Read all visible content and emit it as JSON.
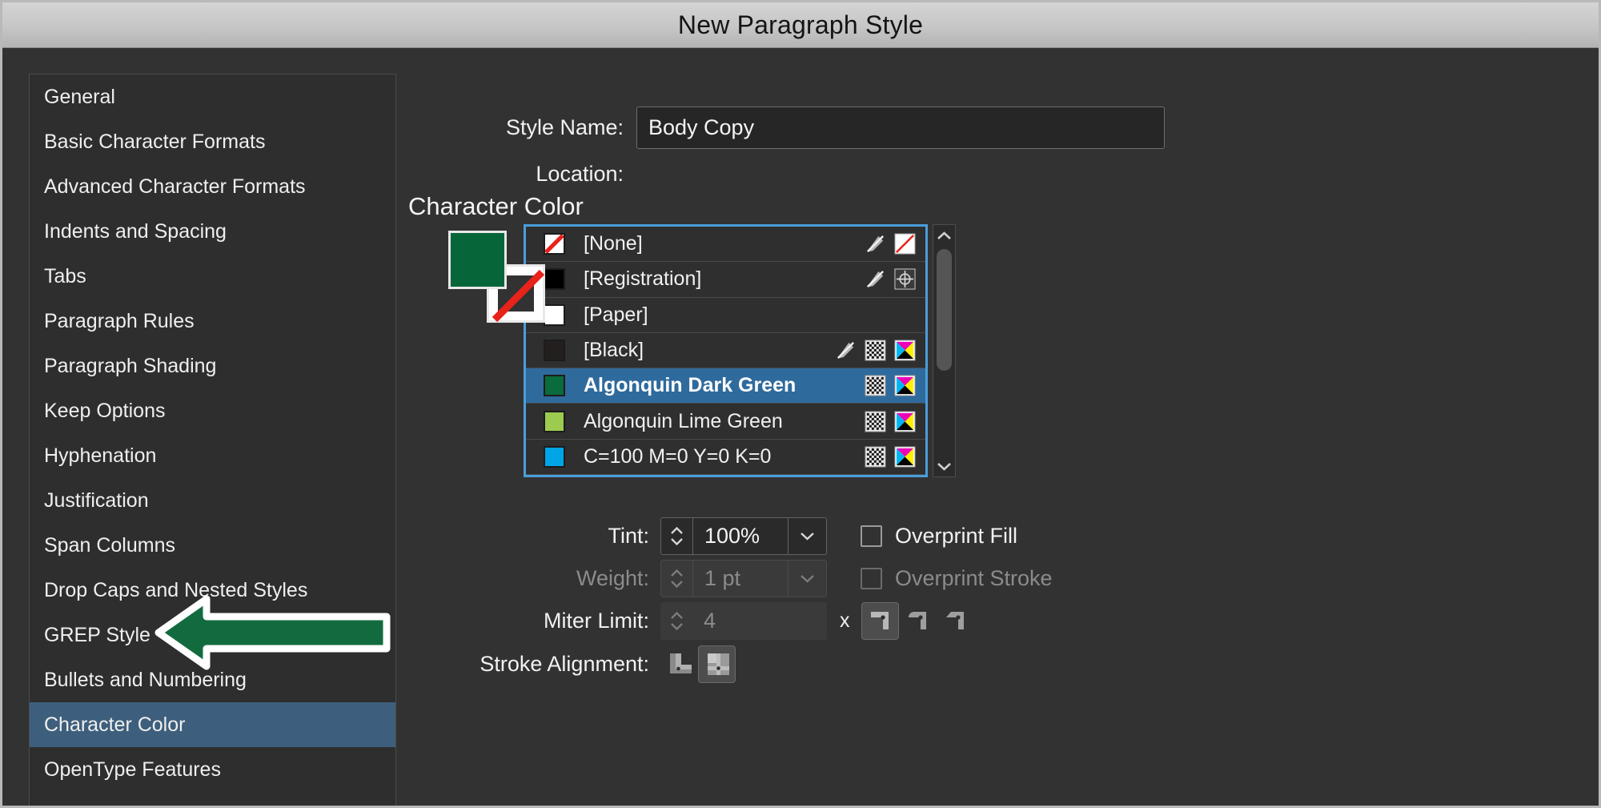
{
  "window": {
    "title": "New Paragraph Style"
  },
  "sidebar": {
    "items": [
      {
        "label": "General",
        "selected": false
      },
      {
        "label": "Basic Character Formats",
        "selected": false
      },
      {
        "label": "Advanced Character Formats",
        "selected": false
      },
      {
        "label": "Indents and Spacing",
        "selected": false
      },
      {
        "label": "Tabs",
        "selected": false
      },
      {
        "label": "Paragraph Rules",
        "selected": false
      },
      {
        "label": "Paragraph Shading",
        "selected": false
      },
      {
        "label": "Keep Options",
        "selected": false
      },
      {
        "label": "Hyphenation",
        "selected": false
      },
      {
        "label": "Justification",
        "selected": false
      },
      {
        "label": "Span Columns",
        "selected": false
      },
      {
        "label": "Drop Caps and Nested Styles",
        "selected": false
      },
      {
        "label": "GREP Style",
        "selected": false
      },
      {
        "label": "Bullets and Numbering",
        "selected": false
      },
      {
        "label": "Character Color",
        "selected": true
      },
      {
        "label": "OpenType Features",
        "selected": false
      }
    ]
  },
  "form": {
    "style_name_label": "Style Name:",
    "style_name_value": "Body Copy",
    "style_name_placeholder": "Style Name",
    "location_label": "Location:",
    "location_value": ""
  },
  "panel": {
    "title": "Character Color"
  },
  "proxy": {
    "fill_color": "#07653a",
    "fill_name": "Algonquin Dark Green",
    "stroke_name": "[None]",
    "none_slash_color": "#e8231a"
  },
  "swatches": {
    "focus_border_color": "#4a9eda",
    "selected_row_color": "#2f6a9c",
    "rows": [
      {
        "label": "[None]",
        "color": "#ffffff",
        "kind": "none",
        "locked": true,
        "tint": false,
        "cmyk": false,
        "none_icon": true,
        "registration_icon": false,
        "selected": false
      },
      {
        "label": "[Registration]",
        "color": "#000000",
        "kind": "registration",
        "locked": true,
        "tint": false,
        "cmyk": false,
        "none_icon": false,
        "registration_icon": true,
        "selected": false
      },
      {
        "label": "[Paper]",
        "color": "#ffffff",
        "kind": "paper",
        "locked": false,
        "tint": false,
        "cmyk": false,
        "none_icon": false,
        "registration_icon": false,
        "selected": false
      },
      {
        "label": "[Black]",
        "color": "#231f1f",
        "kind": "process",
        "locked": true,
        "tint": true,
        "cmyk": true,
        "none_icon": false,
        "registration_icon": false,
        "selected": false
      },
      {
        "label": "Algonquin Dark Green",
        "color": "#0a6b3c",
        "kind": "process",
        "locked": false,
        "tint": true,
        "cmyk": true,
        "none_icon": false,
        "registration_icon": false,
        "selected": true
      },
      {
        "label": "Algonquin Lime Green",
        "color": "#9ccb50",
        "kind": "process",
        "locked": false,
        "tint": true,
        "cmyk": true,
        "none_icon": false,
        "registration_icon": false,
        "selected": false
      },
      {
        "label": "C=100 M=0 Y=0 K=0",
        "color": "#00a5e6",
        "kind": "process",
        "locked": false,
        "tint": true,
        "cmyk": true,
        "none_icon": false,
        "registration_icon": false,
        "selected": false
      }
    ]
  },
  "controls": {
    "tint_label": "Tint:",
    "tint_value": "100%",
    "weight_label": "Weight:",
    "weight_value": "1 pt",
    "weight_disabled": true,
    "miter_label": "Miter Limit:",
    "miter_value": "4",
    "miter_disabled": true,
    "miter_x": "x",
    "stroke_alignment_label": "Stroke Alignment:",
    "overprint_fill_label": "Overprint Fill",
    "overprint_fill_checked": false,
    "overprint_stroke_label": "Overprint Stroke",
    "overprint_stroke_checked": false,
    "overprint_stroke_disabled": true,
    "join_miter": "miter-join",
    "join_round": "round-join",
    "join_bevel": "bevel-join",
    "join_selected": "miter-join",
    "align_center": "stroke-align-center",
    "align_inside": "stroke-align-inside",
    "align_selected": "stroke-align-inside"
  },
  "annotation": {
    "arrow_fill": "#116b3f",
    "arrow_outline": "#ffffff",
    "points_to": "Character Color"
  }
}
